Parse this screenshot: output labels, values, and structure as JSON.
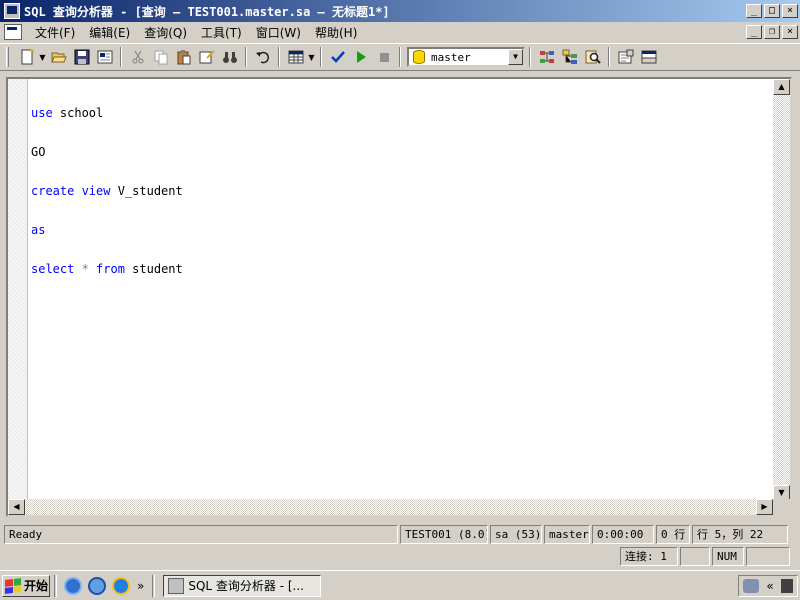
{
  "window": {
    "title": "SQL 查询分析器 - [查询 — TEST001.master.sa — 无标题1*]",
    "minimize": "_",
    "restore": "□",
    "close": "×"
  },
  "menu": {
    "items": [
      "文件(F)",
      "编辑(E)",
      "查询(Q)",
      "工具(T)",
      "窗口(W)",
      "帮助(H)"
    ],
    "child_minimize": "_",
    "child_restore": "❐",
    "child_close": "×"
  },
  "toolbar": {
    "database": "master"
  },
  "editor": {
    "lines": [
      {
        "kw": "use",
        "rest": " school"
      },
      {
        "kw": "",
        "rest": "GO"
      },
      {
        "kw": "create view",
        "rest": " V_student"
      },
      {
        "kw": "as",
        "rest": ""
      },
      {
        "kw": "select",
        "op": " * ",
        "kw2": "from",
        "rest": " student"
      }
    ]
  },
  "status": {
    "state": "Ready",
    "server": "TEST001 (8.0)",
    "user": "sa (53)",
    "database": "master",
    "elapsed": "0:00:00",
    "rows": "0 行",
    "position": "行 5，列 22",
    "connections": "连接: 1",
    "num": "NUM"
  },
  "taskbar": {
    "start_label": "开始",
    "quicklaunch_more": "»",
    "task_label": "SQL 查询分析器 - [...",
    "tray_expand": "«"
  },
  "colors": {
    "keyword": "#0000ff",
    "operator": "#808080",
    "titlebar_start": "#0a246a",
    "titlebar_end": "#a6caf0"
  }
}
